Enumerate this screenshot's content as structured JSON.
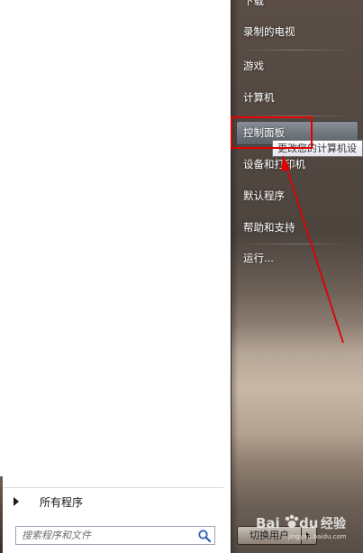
{
  "start_menu": {
    "right_items": [
      {
        "label": "下载"
      },
      {
        "label": "录制的电视"
      },
      {
        "label": "游戏"
      },
      {
        "label": "计算机"
      },
      {
        "label": "控制面板"
      },
      {
        "label": "设备和打印机"
      },
      {
        "label": "默认程序"
      },
      {
        "label": "帮助和支持"
      },
      {
        "label": "运行..."
      }
    ],
    "tooltip": "更改您的计算机设",
    "all_programs_label": "所有程序",
    "search": {
      "placeholder": "搜索程序和文件"
    },
    "shutdown_label": "切换用户"
  },
  "watermark": {
    "text": "Bai du 经验",
    "sub": "jingyan.baidu.com"
  },
  "colors": {
    "annotation": "#e00000",
    "right_pane": "#4d443e"
  },
  "icons": [
    "search-icon",
    "right-arrow-icon",
    "baidu-paw-icon"
  ]
}
